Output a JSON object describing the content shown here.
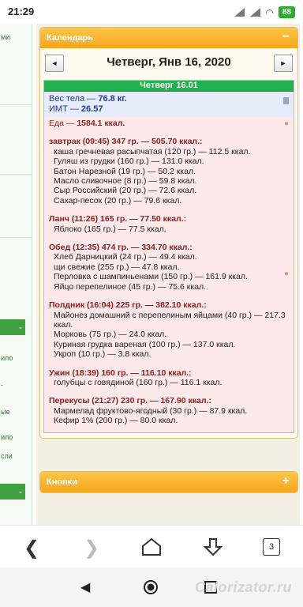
{
  "status": {
    "time": "21:29",
    "battery": "88"
  },
  "left_fragments": [
    "ми",
    "-",
    "ило",
    "-",
    "ые",
    "ило",
    "сли",
    "-"
  ],
  "calendar": {
    "header": "Календарь",
    "collapse_symbol": "−",
    "prev": "◄",
    "next": "►",
    "date": "Четверг, Янв 16, 2020",
    "day_bar": "Четверг 16.01",
    "weight_label": "Вес тела — ",
    "weight_value": "76.8 кг.",
    "bmi_label": "ИМТ — ",
    "bmi_value": "26.57",
    "food_label": "Еда — ",
    "food_value": "1584.1 ккал."
  },
  "meals": [
    {
      "title": "завтрак (09:45) 347 гр. — 505.70 ккал.:",
      "items": [
        "каша гречневая расыпчатая (120 гр.) — 112.5 ккал.",
        "Гуляш из грудки (160 гр.) — 131.0 ккал.",
        "Батон Нарезной (19 гр.) — 50.2 ккал.",
        "Масло сливочное (8 гр.) — 59.8 ккал.",
        "Сыр Российский (20 гр.) — 72.6 ккал.",
        "Сахар-песок (20 гр.) — 79.6 ккал."
      ]
    },
    {
      "title": "Ланч (11:26) 165 гр. — 77.50 ккал.:",
      "items": [
        "Яблоко (165 гр.) — 77.5 ккал."
      ]
    },
    {
      "title": "Обед (12:35) 474 гр. — 334.70 ккал.:",
      "items": [
        "Хлеб Дарницкий (24 гр.) — 49.4 ккал.",
        "щи свежие (255 гр.) — 47.8 ккал.",
        "Перловка с шампиньенами (150 гр.) — 161.9 ккал.",
        "Яйцо перепелиное (45 гр.) — 75.6 ккал."
      ]
    },
    {
      "title": "Полдник (16:04) 225 гр. — 382.10 ккал.:",
      "items": [
        "Майонез домашний с перепелиным яйцами (40 гр.) — 217.3 ккал.",
        "Морковь (75 гр.) — 24.0 ккал.",
        "Куриная грудка вареная (100 гр.) — 137.0 ккал.",
        "Укроп (10 гр.) — 3.8 ккал."
      ]
    },
    {
      "title": "Ужин (18:39) 160 гр. — 116.10 ккал.:",
      "items": [
        "голубцы с говядиной (160 гр.) — 116.1 ккал."
      ]
    },
    {
      "title": "Перекусы (21:27) 230 гр. — 167.90 ккал.:",
      "items": [
        "Мармелад фруктово-ягодный (30 гр.) — 87.9 ккал.",
        "Кефир 1% (200 гр.) — 80.0 ккал."
      ]
    }
  ],
  "buttons_panel": {
    "header": "Кнопки",
    "expand_symbol": "+"
  },
  "browser": {
    "back": "❮",
    "forward": "❯",
    "tabs": "3"
  },
  "watermark": "Calorizator.ru"
}
